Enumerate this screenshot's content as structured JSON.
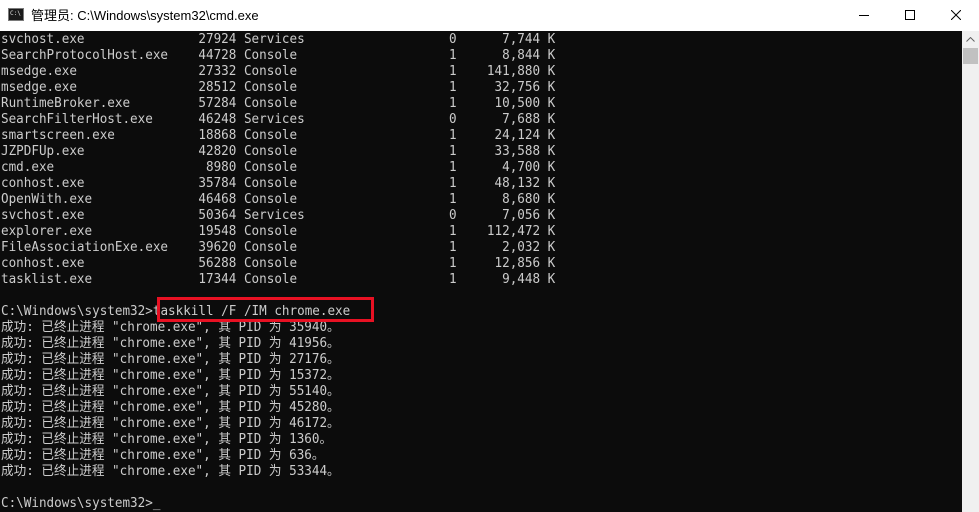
{
  "window": {
    "title": "管理员: C:\\Windows\\system32\\cmd.exe",
    "app_icon_text": "C:\\"
  },
  "processes": [
    {
      "name": "svchost.exe",
      "pid": "27924",
      "session": "Services",
      "session_num": "0",
      "mem": "7,744 K"
    },
    {
      "name": "SearchProtocolHost.exe",
      "pid": "44728",
      "session": "Console",
      "session_num": "1",
      "mem": "8,844 K"
    },
    {
      "name": "msedge.exe",
      "pid": "27332",
      "session": "Console",
      "session_num": "1",
      "mem": "141,880 K"
    },
    {
      "name": "msedge.exe",
      "pid": "28512",
      "session": "Console",
      "session_num": "1",
      "mem": "32,756 K"
    },
    {
      "name": "RuntimeBroker.exe",
      "pid": "57284",
      "session": "Console",
      "session_num": "1",
      "mem": "10,500 K"
    },
    {
      "name": "SearchFilterHost.exe",
      "pid": "46248",
      "session": "Services",
      "session_num": "0",
      "mem": "7,688 K"
    },
    {
      "name": "smartscreen.exe",
      "pid": "18868",
      "session": "Console",
      "session_num": "1",
      "mem": "24,124 K"
    },
    {
      "name": "JZPDFUp.exe",
      "pid": "42820",
      "session": "Console",
      "session_num": "1",
      "mem": "33,588 K"
    },
    {
      "name": "cmd.exe",
      "pid": "8980",
      "session": "Console",
      "session_num": "1",
      "mem": "4,700 K"
    },
    {
      "name": "conhost.exe",
      "pid": "35784",
      "session": "Console",
      "session_num": "1",
      "mem": "48,132 K"
    },
    {
      "name": "OpenWith.exe",
      "pid": "46468",
      "session": "Console",
      "session_num": "1",
      "mem": "8,680 K"
    },
    {
      "name": "svchost.exe",
      "pid": "50364",
      "session": "Services",
      "session_num": "0",
      "mem": "7,056 K"
    },
    {
      "name": "explorer.exe",
      "pid": "19548",
      "session": "Console",
      "session_num": "1",
      "mem": "112,472 K"
    },
    {
      "name": "FileAssociationExe.exe",
      "pid": "39620",
      "session": "Console",
      "session_num": "1",
      "mem": "2,032 K"
    },
    {
      "name": "conhost.exe",
      "pid": "56288",
      "session": "Console",
      "session_num": "1",
      "mem": "12,856 K"
    },
    {
      "name": "tasklist.exe",
      "pid": "17344",
      "session": "Console",
      "session_num": "1",
      "mem": "9,448 K"
    }
  ],
  "command": {
    "prompt": "C:\\Windows\\system32>",
    "text": "taskkill /F /IM chrome.exe"
  },
  "results": [
    "成功: 已终止进程 \"chrome.exe\", 其 PID 为 35940。",
    "成功: 已终止进程 \"chrome.exe\", 其 PID 为 41956。",
    "成功: 已终止进程 \"chrome.exe\", 其 PID 为 27176。",
    "成功: 已终止进程 \"chrome.exe\", 其 PID 为 15372。",
    "成功: 已终止进程 \"chrome.exe\", 其 PID 为 55140。",
    "成功: 已终止进程 \"chrome.exe\", 其 PID 为 45280。",
    "成功: 已终止进程 \"chrome.exe\", 其 PID 为 46172。",
    "成功: 已终止进程 \"chrome.exe\", 其 PID 为 1360。",
    "成功: 已终止进程 \"chrome.exe\", 其 PID 为 636。",
    "成功: 已终止进程 \"chrome.exe\", 其 PID 为 53344。"
  ],
  "final_prompt": "C:\\Windows\\system32>",
  "colors": {
    "console_bg": "#0c0c0c",
    "console_fg": "#cccccc",
    "highlight": "#e81123"
  }
}
